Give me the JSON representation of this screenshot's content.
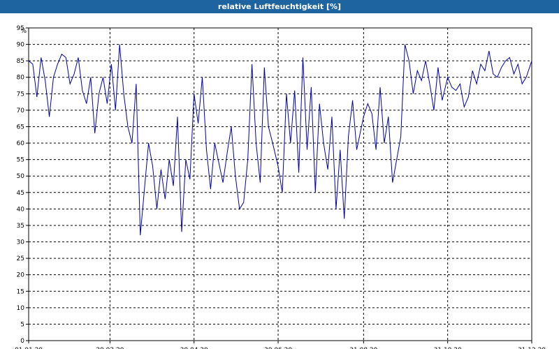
{
  "window": {
    "title": "relative Luftfeuchtigkeit [%]"
  },
  "chart_data": {
    "type": "line",
    "title": "relative Luftfeuchtigkeit [%]",
    "ylabel": "%",
    "xlabel": "",
    "ylim": [
      0,
      95
    ],
    "yticks": [
      0,
      5,
      10,
      15,
      20,
      25,
      30,
      35,
      40,
      45,
      50,
      55,
      60,
      65,
      70,
      75,
      80,
      85,
      90,
      95
    ],
    "xlim": [
      "01.01.20",
      "31.12.20"
    ],
    "xticks": [
      "01.01.20",
      "29.02.20",
      "30.04.20",
      "30.06.20",
      "31.08.20",
      "31.10.20",
      "31.12.20"
    ],
    "grid": true,
    "colors": {
      "line": "#0000aa",
      "grid": "#000000",
      "title_bar": "#1e64a0"
    },
    "series": [
      {
        "x": [
          "01.01.20",
          "04.01.20",
          "07.01.20",
          "10.01.20",
          "13.01.20",
          "16.01.20",
          "19.01.20",
          "22.01.20",
          "25.01.20",
          "28.01.20",
          "31.01.20",
          "03.02.20",
          "06.02.20",
          "09.02.20",
          "12.02.20",
          "15.02.20",
          "18.02.20",
          "21.02.20",
          "24.02.20",
          "27.02.20",
          "01.03.20",
          "04.03.20",
          "07.03.20",
          "10.03.20",
          "13.03.20",
          "16.03.20",
          "19.03.20",
          "22.03.20",
          "25.03.20",
          "28.03.20",
          "31.03.20",
          "03.04.20",
          "06.04.20",
          "09.04.20",
          "12.04.20",
          "15.04.20",
          "18.04.20",
          "21.04.20",
          "24.04.20",
          "27.04.20",
          "30.04.20",
          "03.05.20",
          "06.05.20",
          "09.05.20",
          "12.05.20",
          "15.05.20",
          "18.05.20",
          "21.05.20",
          "24.05.20",
          "27.05.20",
          "30.05.20",
          "02.06.20",
          "05.06.20",
          "08.06.20",
          "11.06.20",
          "14.06.20",
          "17.06.20",
          "20.06.20",
          "23.06.20",
          "26.06.20",
          "30.06.20",
          "03.07.20",
          "06.07.20",
          "09.07.20",
          "12.07.20",
          "15.07.20",
          "18.07.20",
          "21.07.20",
          "24.07.20",
          "27.07.20",
          "30.07.20",
          "02.08.20",
          "05.08.20",
          "08.08.20",
          "11.08.20",
          "14.08.20",
          "17.08.20",
          "20.08.20",
          "23.08.20",
          "26.08.20",
          "31.08.20",
          "03.09.20",
          "06.09.20",
          "09.09.20",
          "12.09.20",
          "15.09.20",
          "18.09.20",
          "21.09.20",
          "24.09.20",
          "27.09.20",
          "30.09.20",
          "03.10.20",
          "06.10.20",
          "09.10.20",
          "12.10.20",
          "15.10.20",
          "18.10.20",
          "21.10.20",
          "24.10.20",
          "27.10.20",
          "31.10.20",
          "03.11.20",
          "06.11.20",
          "09.11.20",
          "12.11.20",
          "15.11.20",
          "18.11.20",
          "21.11.20",
          "24.11.20",
          "27.11.20",
          "30.11.20",
          "03.12.20",
          "06.12.20",
          "09.12.20",
          "12.12.20",
          "15.12.20",
          "18.12.20",
          "21.12.20",
          "24.12.20",
          "27.12.20",
          "31.12.20"
        ],
        "y": [
          85,
          84,
          74,
          86,
          79,
          68,
          80,
          84,
          87,
          86,
          78,
          81,
          86,
          76,
          72,
          80,
          63,
          75,
          80,
          72,
          84,
          70,
          90,
          75,
          65,
          60,
          78,
          32,
          46,
          60,
          53,
          40,
          52,
          43,
          55,
          47,
          68,
          33,
          55,
          49,
          75,
          66,
          80,
          58,
          46,
          60,
          54,
          48,
          57,
          65,
          50,
          40,
          42,
          55,
          84,
          60,
          48,
          83,
          65,
          60,
          53,
          45,
          75,
          60,
          76,
          51,
          86,
          58,
          77,
          45,
          72,
          60,
          52,
          68,
          40,
          58,
          37,
          62,
          73,
          58,
          68,
          72,
          69,
          58,
          77,
          60,
          68,
          48,
          55,
          62,
          90,
          85,
          75,
          82,
          79,
          85,
          78,
          70,
          83,
          73,
          80,
          77,
          76,
          78,
          71,
          74,
          82,
          78,
          84,
          82,
          88,
          81,
          80,
          83,
          85,
          86,
          81,
          84,
          78,
          80,
          85
        ]
      }
    ]
  }
}
